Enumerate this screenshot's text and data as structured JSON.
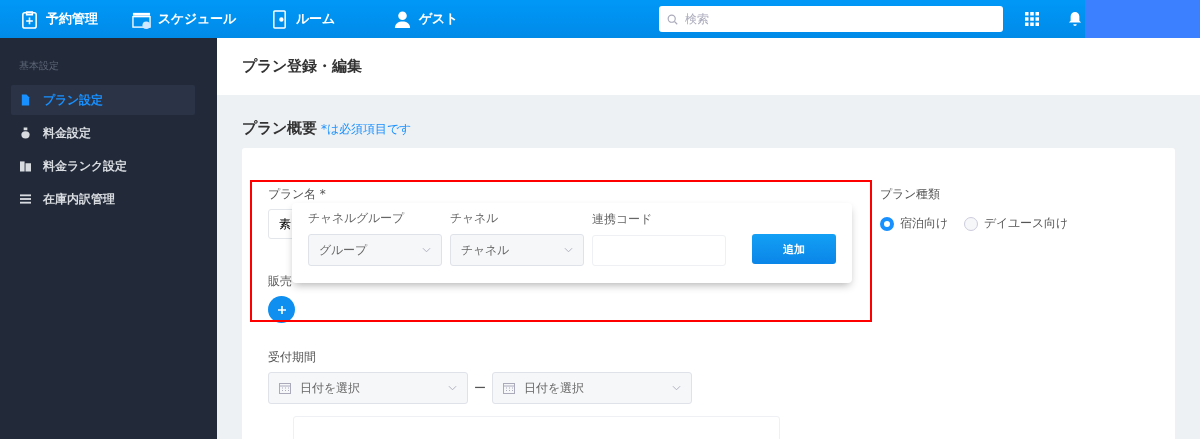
{
  "topbar": {
    "nav": [
      {
        "kind": "clipboard",
        "label": "予約管理"
      },
      {
        "kind": "calendar",
        "label": "スケジュール"
      },
      {
        "kind": "door",
        "label": "ルーム"
      },
      {
        "kind": "person",
        "label": "ゲスト"
      }
    ],
    "search": {
      "placeholder": "検索"
    }
  },
  "sidebar": {
    "section": "基本設定",
    "items": [
      {
        "kind": "file",
        "label": "プラン設定",
        "selected": true
      },
      {
        "kind": "bag",
        "label": "料金設定",
        "selected": false
      },
      {
        "kind": "stack",
        "label": "料金ランク設定",
        "selected": false
      },
      {
        "kind": "list",
        "label": "在庫内訳管理",
        "selected": false
      }
    ]
  },
  "page_title": "プラン登録・編集",
  "section": {
    "title": "プラン概要",
    "note": "*は必須項目です"
  },
  "form": {
    "plan_name": {
      "label": "プラン名 *",
      "value": "素"
    },
    "plan_type": {
      "label": "プラン種類",
      "options": [
        {
          "label": "宿泊向け",
          "selected": true
        },
        {
          "label": "デイユース向け",
          "selected": false
        }
      ]
    },
    "sales_label": "販売",
    "reception": {
      "label": "受付期間",
      "start": {
        "placeholder": "日付を選択"
      },
      "separator": "ー",
      "end": {
        "placeholder": "日付を選択"
      }
    }
  },
  "popup": {
    "group": {
      "label": "チャネルグループ",
      "value": "グループ"
    },
    "channel": {
      "label": "チャネル",
      "value": "チャネル"
    },
    "code": {
      "label": "連携コード"
    },
    "button": "追加"
  }
}
